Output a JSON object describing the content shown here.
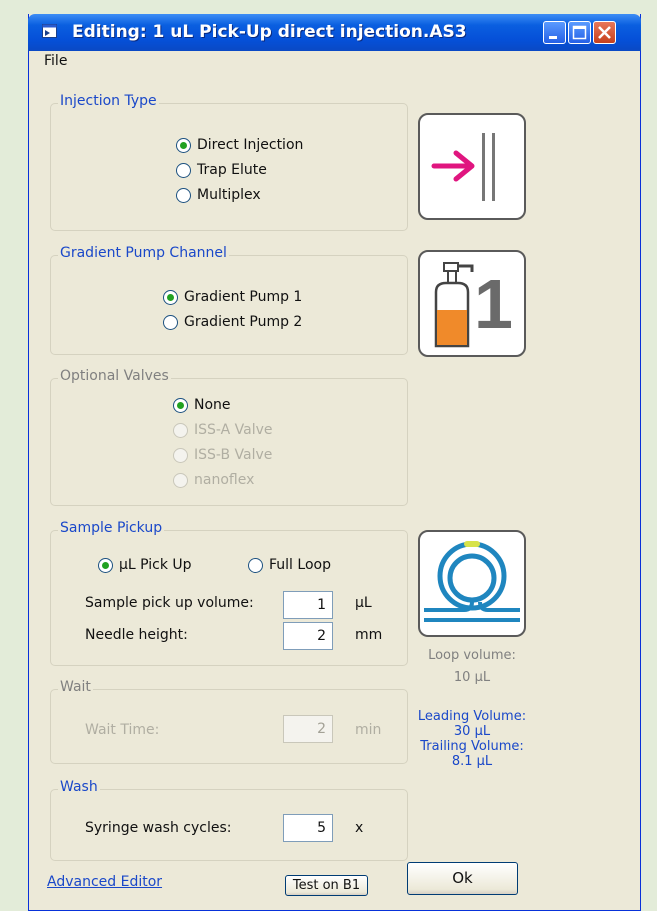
{
  "window": {
    "title": "Editing: 1 uL Pick-Up direct injection.AS3",
    "menu": [
      "File"
    ]
  },
  "injection_type": {
    "label": "Injection Type",
    "options": [
      "Direct Injection",
      "Trap Elute",
      "Multiplex"
    ],
    "selected": "Direct Injection",
    "icon": "direct-injection-icon"
  },
  "gradient_pump": {
    "label": "Gradient Pump Channel",
    "options": [
      "Gradient Pump 1",
      "Gradient Pump 2"
    ],
    "selected": "Gradient Pump 1",
    "icon": "pump-1-icon",
    "icon_number": "1"
  },
  "optional_valves": {
    "label": "Optional Valves",
    "options": [
      "None",
      "ISS-A Valve",
      "ISS-B Valve",
      "nanoflex"
    ],
    "selected": "None"
  },
  "sample_pickup": {
    "label": "Sample Pickup",
    "options": [
      "µL Pick Up",
      "Full Loop"
    ],
    "selected": "µL Pick Up",
    "volume_label": "Sample pick up volume:",
    "volume_value": "1",
    "volume_unit": "µL",
    "height_label": "Needle height:",
    "height_value": "2",
    "height_unit": "mm",
    "icon": "sample-loop-icon"
  },
  "loop_info": {
    "loop_volume_label": "Loop volume:",
    "loop_volume_value": "10 µL",
    "leading_label": "Leading Volume:",
    "leading_value": "30 µL",
    "trailing_label": "Trailing Volume:",
    "trailing_value": "8.1 µL"
  },
  "wait": {
    "label": "Wait",
    "time_label": "Wait Time:",
    "time_value": "2",
    "time_unit": "min"
  },
  "wash": {
    "label": "Wash",
    "cycles_label": "Syringe wash cycles:",
    "cycles_value": "5",
    "cycles_unit": "x"
  },
  "footer": {
    "advanced_link": "Advanced Editor",
    "test_button": "Test on B1",
    "ok_button": "Ok"
  },
  "colors": {
    "accent": "#1a48c9",
    "arrow": "#e0157f",
    "bottle": "#f08a2a",
    "loop": "#1f86bf"
  }
}
